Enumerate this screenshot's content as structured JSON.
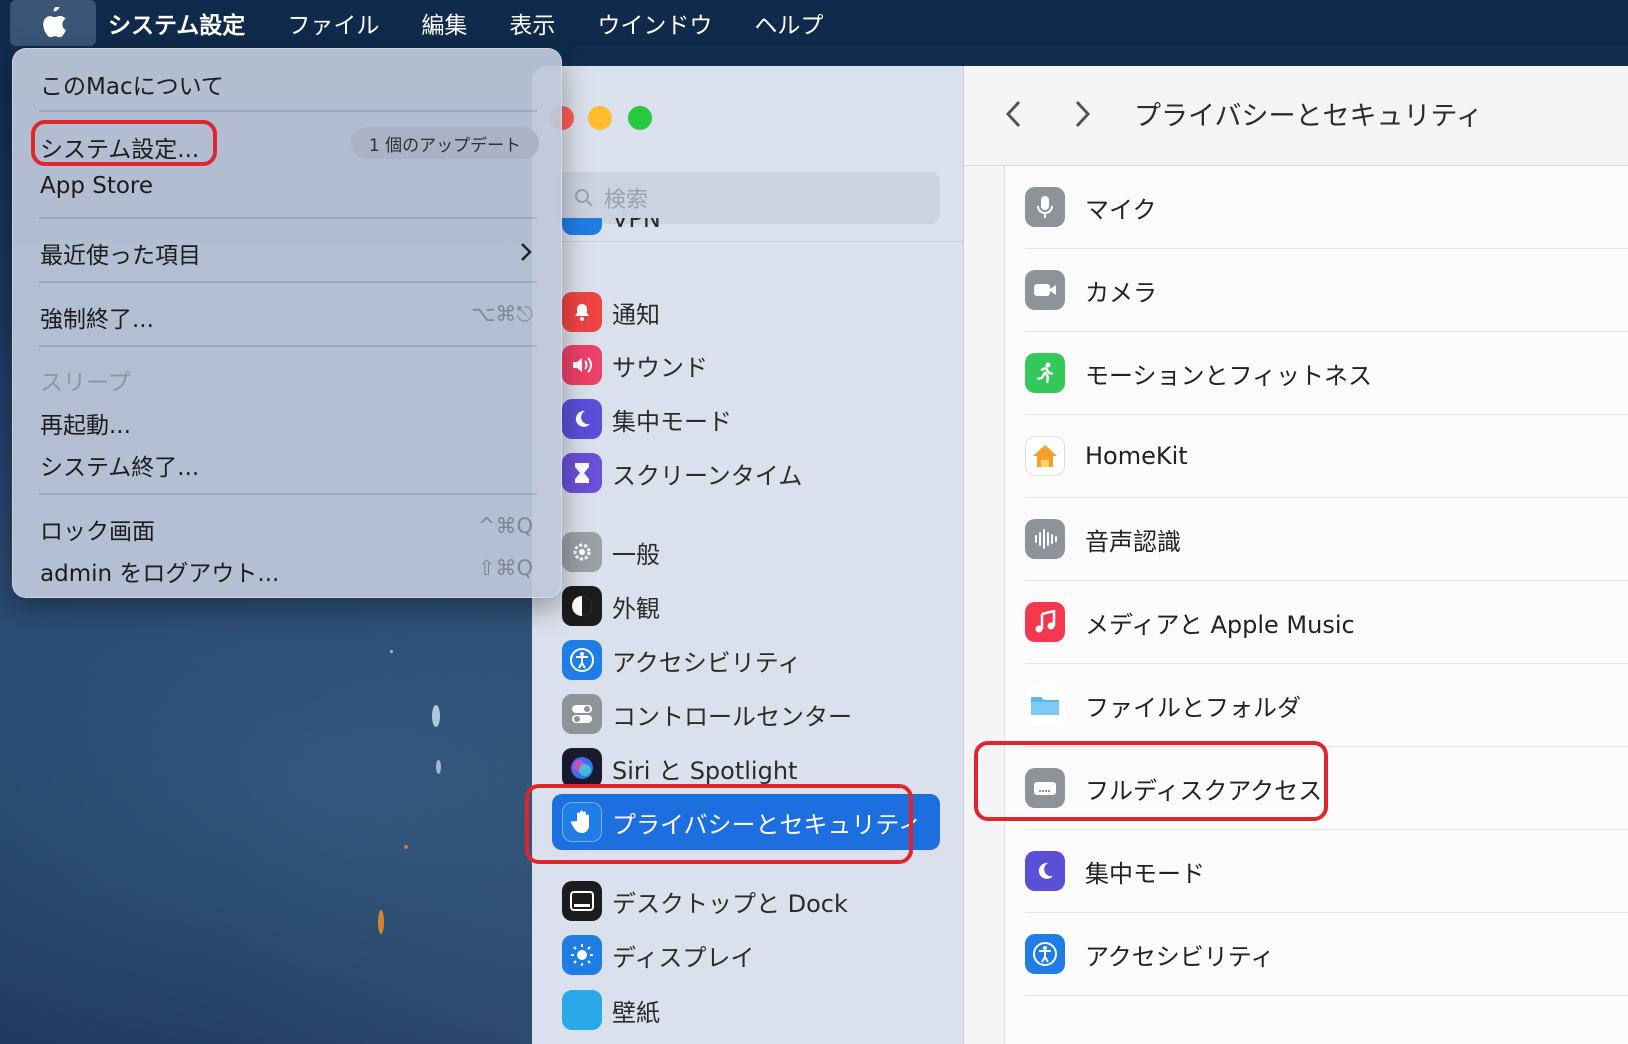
{
  "menubar": {
    "app_name": "システム設定",
    "items": [
      "ファイル",
      "編集",
      "表示",
      "ウインドウ",
      "ヘルプ"
    ]
  },
  "apple_menu": {
    "about": "このMacについて",
    "system_settings": "システム設定...",
    "update_badge": "1 個のアップデート",
    "app_store": "App Store",
    "recent_items": "最近使った項目",
    "force_quit": "強制終了...",
    "force_quit_shortcut": "⌥⌘⎋",
    "sleep": "スリープ",
    "restart": "再起動...",
    "shutdown": "システム終了...",
    "lock_screen": "ロック画面",
    "lock_shortcut": "^⌘Q",
    "logout": "admin をログアウト...",
    "logout_shortcut": "⇧⌘Q"
  },
  "sidebar": {
    "search_placeholder": "検索",
    "partial_item": "VPN",
    "items": [
      {
        "label": "通知",
        "icon": "bell-icon",
        "color": "#ef4444"
      },
      {
        "label": "サウンド",
        "icon": "speaker-icon",
        "color": "#ec4067"
      },
      {
        "label": "集中モード",
        "icon": "moon-icon",
        "color": "#5b4fd8"
      },
      {
        "label": "スクリーンタイム",
        "icon": "hourglass-icon",
        "color": "#6a4fd8"
      },
      {
        "label": "一般",
        "icon": "gear-icon",
        "color": "#9aa0a8"
      },
      {
        "label": "外観",
        "icon": "appearance-icon",
        "color": "#1c1c1e"
      },
      {
        "label": "アクセシビリティ",
        "icon": "accessibility-icon",
        "color": "#1f7de6"
      },
      {
        "label": "コントロールセンター",
        "icon": "toggles-icon",
        "color": "#8e9299"
      },
      {
        "label": "Siri と Spotlight",
        "icon": "siri-icon",
        "color": "#1a1a2e"
      },
      {
        "label": "プライバシーとセキュリティ",
        "icon": "hand-icon",
        "color": "#1f7de6"
      },
      {
        "label": "デスクトップと Dock",
        "icon": "dock-icon",
        "color": "#1c1c1e"
      },
      {
        "label": "ディスプレイ",
        "icon": "sun-icon",
        "color": "#1f7de6"
      },
      {
        "label": "壁紙",
        "icon": "flower-icon",
        "color": "#2aa8e8"
      }
    ]
  },
  "main": {
    "title": "プライバシーとセキュリティ",
    "rows": [
      {
        "label": "マイク",
        "icon": "microphone-icon",
        "color": "#8e9299"
      },
      {
        "label": "カメラ",
        "icon": "camera-icon",
        "color": "#8e9299"
      },
      {
        "label": "モーションとフィットネス",
        "icon": "fitness-icon",
        "color": "#34c759"
      },
      {
        "label": "HomeKit",
        "icon": "home-icon",
        "color": "#ffffff"
      },
      {
        "label": "音声認識",
        "icon": "waveform-icon",
        "color": "#8e9299"
      },
      {
        "label": "メディアと Apple Music",
        "icon": "music-icon",
        "color": "#f2384e"
      },
      {
        "label": "ファイルとフォルダ",
        "icon": "folder-icon",
        "color": "#ffffff"
      },
      {
        "label": "フルディスクアクセス",
        "icon": "disk-icon",
        "color": "#8e9299"
      },
      {
        "label": "集中モード",
        "icon": "moon-icon",
        "color": "#5b4fd8"
      },
      {
        "label": "アクセシビリティ",
        "icon": "accessibility-icon",
        "color": "#1f7de6"
      }
    ]
  }
}
